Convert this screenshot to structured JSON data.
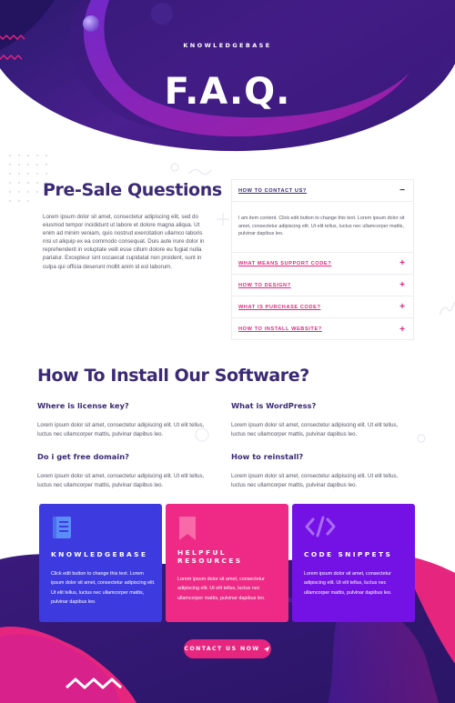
{
  "colors": {
    "deep_purple": "#3b1a7a",
    "violet": "#6e2bd1",
    "pink": "#e6257f",
    "blue": "#3d3be0",
    "heading": "#3b2a74"
  },
  "hero": {
    "subtitle": "KNOWLEDGEBASE",
    "title": "F.A.Q."
  },
  "presale": {
    "title": "Pre-Sale Questions",
    "text": "Lorem ipsum dolor sit amet, consectetur adipiscing elit, sed do eiusmod tempor incididunt ut labore et dolore magna aliqua. Ut enim ad minim veniam, quis nostrud exercitation ullamco laboris nisi ut aliquip ex ea commodo consequat. Duis aute irure dolor in reprehenderit in voluptate velit esse cillum dolore eu fugiat nulla pariatur. Excepteur sint occaecat cupidatat non proident, sunt in culpa qui officia deserunt mollit anim id est laborum."
  },
  "faq": {
    "open_item": {
      "question": "HOW TO CONTACT US?",
      "sign": "−",
      "answer": "I am item content. Click edit button to change this text. Lorem ipsum dolor sit amet, consectetur adipiscing elit. Ut elit tellus, luctus nec ullamcorper mattis, pulvinar dapibus leo."
    },
    "items": [
      {
        "question": "WHAT MEANS SUPPORT CODE?",
        "sign": "+"
      },
      {
        "question": "HOW TO DESIGN?",
        "sign": "+"
      },
      {
        "question": "WHAT IS PURCHASE CODE?",
        "sign": "+"
      },
      {
        "question": "HOW TO INSTALL WEBSITE?",
        "sign": "+"
      }
    ]
  },
  "install": {
    "title": "How To Install Our Software?",
    "qas": [
      {
        "question": "Where is license key?",
        "answer": "Lorem ipsum dolor sit amet, consectetur adipiscing elit. Ut elit tellus, luctus nec ullamcorper mattis, pulvinar dapibus leo."
      },
      {
        "question": "What is WordPress?",
        "answer": "Lorem ipsum dolor sit amet, consectetur adipiscing elit. Ut elit tellus, luctus nec ullamcorper mattis, pulvinar dapibus leo."
      },
      {
        "question": "Do i get free domain?",
        "answer": "Lorem ipsum dolor sit amet, consectetur adipiscing elit. Ut elit tellus, luctus nec ullamcorper mattis, pulvinar dapibus leo."
      },
      {
        "question": "How to reinstall?",
        "answer": "Lorem ipsum dolor sit amet, consectetur adipiscing elit. Ut elit tellus, luctus nec ullamcorper mattis, pulvinar dapibus leo."
      }
    ]
  },
  "cards": [
    {
      "icon": "book-icon",
      "title": "KNOWLEDGEBASE",
      "text": "Click edit button to change this text. Lorem ipsum dolor sit amet, consectetur adipiscing elit. Ut elit tellus, luctus nec ullamcorper mattis, pulvinar dapibus leo.",
      "color": "#3d3be0"
    },
    {
      "icon": "bookmark-icon",
      "title": "HELPFUL RESOURCES",
      "text": "Lorem ipsum dolor sit amet, consectetur adipiscing elit. Ut elit tellus, luctus nec ullamcorper mattis, pulvinar dapibus leo.",
      "color": "#ee2a86"
    },
    {
      "icon": "code-icon",
      "title": "CODE SNIPPETS",
      "text": "Lorem ipsum dolor sit amet, consectetur adipiscing elit. Ut elit tellus, luctus nec ullamcorper mattis, pulvinar dapibus leo.",
      "color": "#7412e6"
    }
  ],
  "contact_button": {
    "label": "CONTACT US NOW",
    "icon": "send-icon"
  }
}
